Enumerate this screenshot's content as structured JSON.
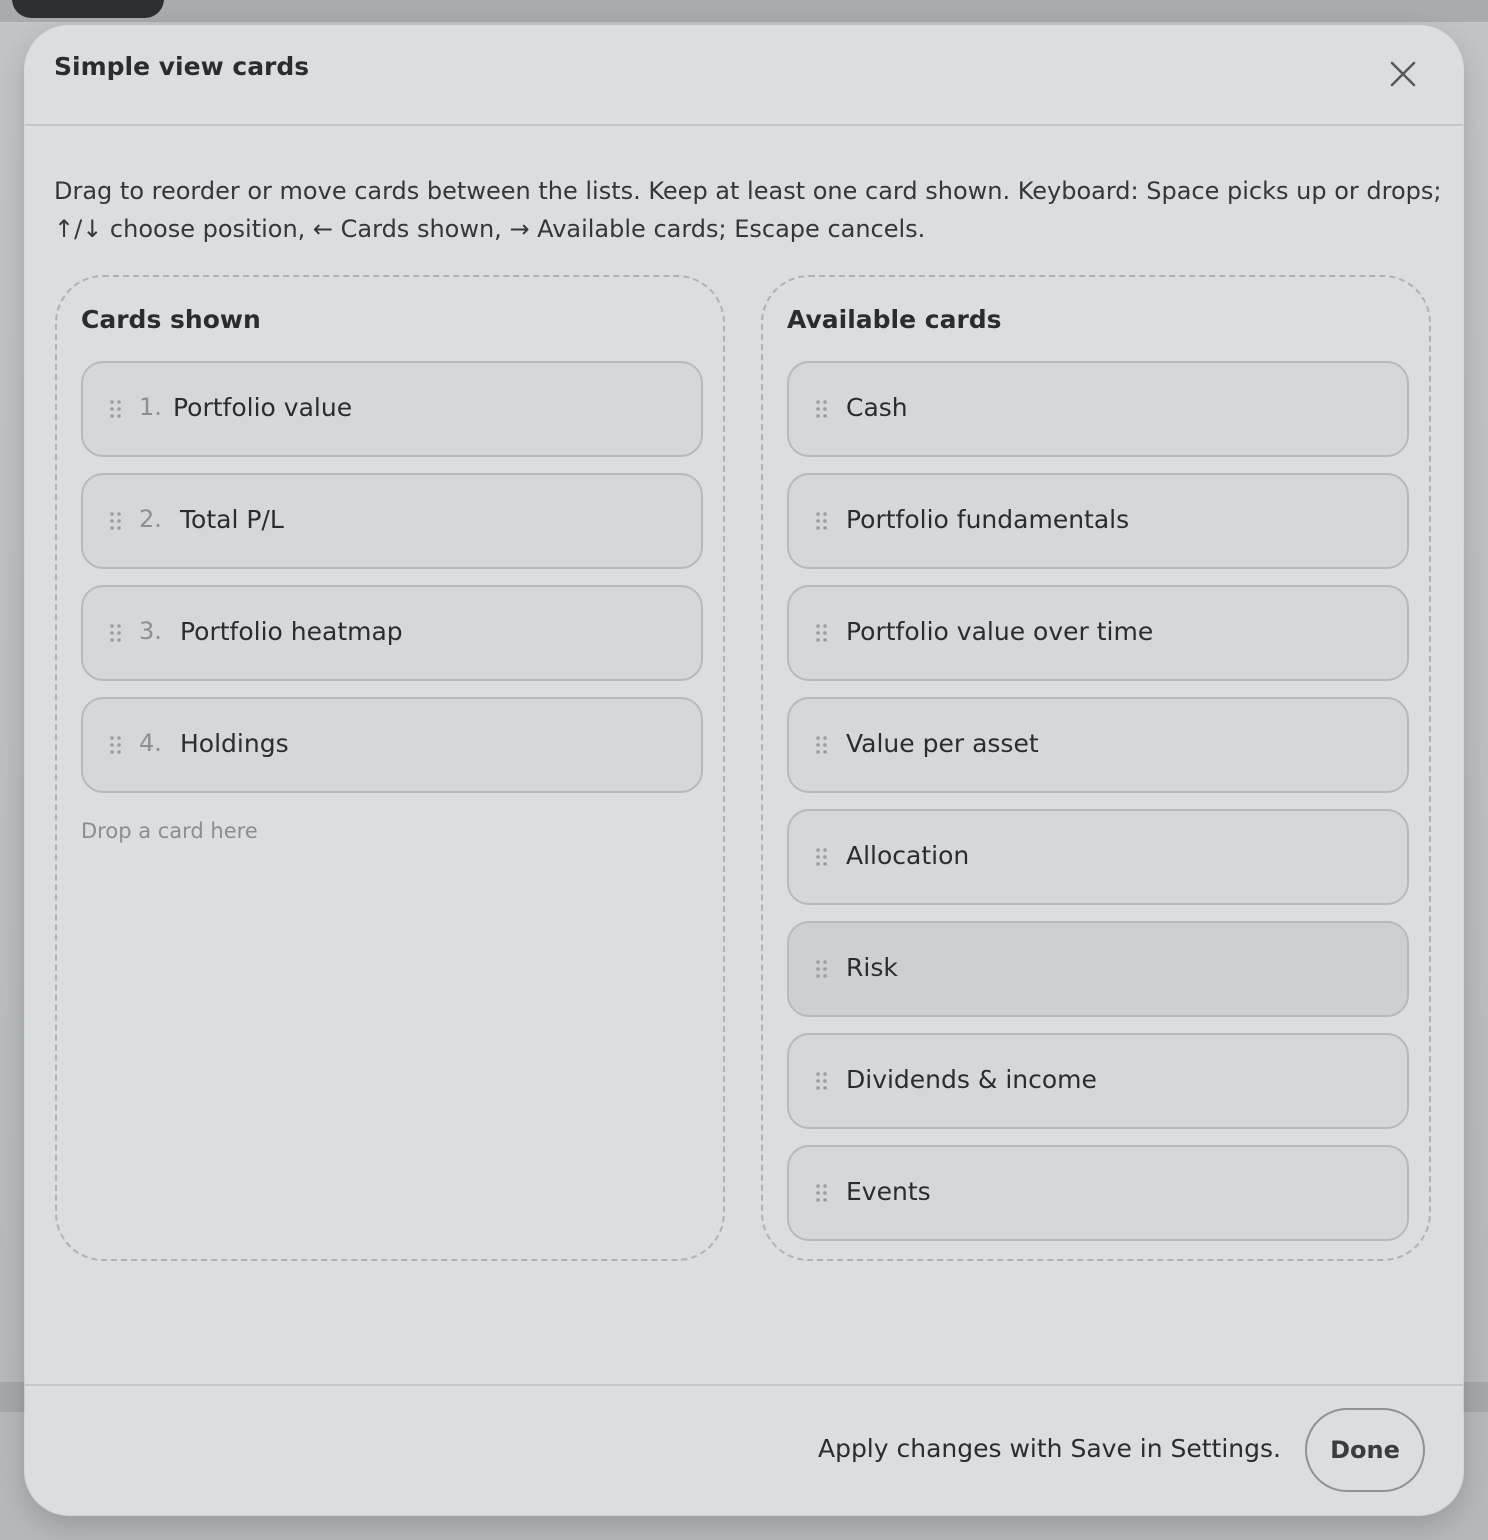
{
  "modal": {
    "title": "Simple view cards",
    "close_icon": "close-icon",
    "instructions": "Drag to reorder or move cards between the lists. Keep at least one card shown. Keyboard: Space picks up or drops; ↑/↓ choose position, ← Cards shown, → Available cards; Escape cancels."
  },
  "shown": {
    "title": "Cards shown",
    "items": [
      {
        "num": "1.",
        "label": "Portfolio value"
      },
      {
        "num": "2.",
        "label": "Total P/L"
      },
      {
        "num": "3.",
        "label": "Portfolio heatmap"
      },
      {
        "num": "4.",
        "label": "Holdings"
      }
    ],
    "drop_hint": "Drop a card here"
  },
  "available": {
    "title": "Available cards",
    "items": [
      {
        "label": "Cash"
      },
      {
        "label": "Portfolio fundamentals"
      },
      {
        "label": "Portfolio value over time"
      },
      {
        "label": "Value per asset"
      },
      {
        "label": "Allocation"
      },
      {
        "label": "Risk"
      },
      {
        "label": "Dividends & income"
      },
      {
        "label": "Events"
      }
    ]
  },
  "footer": {
    "note": "Apply changes with Save in Settings.",
    "done_label": "Done"
  },
  "icons": {
    "drag_handle": "drag-handle-icon"
  },
  "colors": {
    "modal_bg": "#dcdde0",
    "card_bg": "#d6d7da",
    "card_border": "#b7b9bd",
    "text": "#2a2c2f",
    "muted": "#8c8f93"
  }
}
